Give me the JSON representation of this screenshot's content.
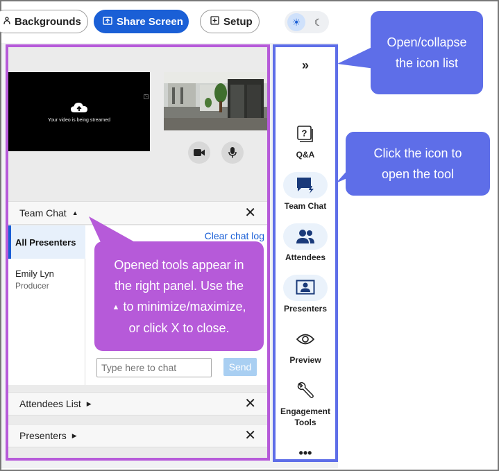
{
  "toolbar": {
    "backgrounds_label": "Backgrounds",
    "share_screen_label": "Share Screen",
    "setup_label": "Setup"
  },
  "video": {
    "share_message": "Your video is being streamed"
  },
  "team_chat": {
    "title": "Team Chat",
    "tab_all": "All Presenters",
    "clear_log": "Clear chat log",
    "participant_name": "Emily Lyn",
    "participant_role": "Producer",
    "input_placeholder": "Type here to chat",
    "send_label": "Send"
  },
  "collapsed_tools": [
    {
      "label": "Attendees List"
    },
    {
      "label": "Presenters"
    }
  ],
  "rail": {
    "toggle_glyph": "»",
    "items": [
      {
        "label": "Q&A",
        "icon": "qa-icon"
      },
      {
        "label": "Team Chat",
        "icon": "team-chat-icon",
        "active": true
      },
      {
        "label": "Attendees",
        "icon": "attendees-icon"
      },
      {
        "label": "Presenters",
        "icon": "presenters-icon"
      },
      {
        "label": "Preview",
        "icon": "eye-icon"
      },
      {
        "label": "Engagement Tools",
        "icon": "wrench-icon"
      }
    ],
    "more_glyph": "•••"
  },
  "callouts": {
    "toggle": "Open/collapse the icon list",
    "click": "Click the icon to open the tool",
    "opened_line1": "Opened tools appear in",
    "opened_line2": "the right panel. Use the",
    "opened_line3": "to minimize/maximize,",
    "opened_line4": "or click X to close."
  },
  "colors": {
    "primary": "#1a5fd6",
    "rail_border": "#5e6ee8",
    "panel_border": "#b65ad9",
    "send_disabled": "#a9cff2"
  }
}
